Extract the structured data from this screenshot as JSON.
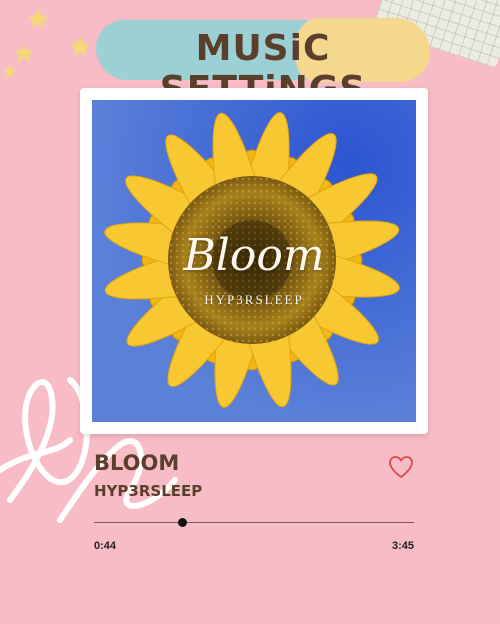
{
  "header": {
    "title": "MUSiC SETTiNGS"
  },
  "cover": {
    "title": "Bloom",
    "artist": "HYP3RSLEEP"
  },
  "track": {
    "title": "BLOOM",
    "artist": "HYP3RSLEEP"
  },
  "player": {
    "current_time": "0:44",
    "total_time": "3:45",
    "progress": 0.2756,
    "liked": false
  },
  "colors": {
    "background": "#f7bcc6",
    "text": "#5a3f2c",
    "banner_blue": "#9bd0d5",
    "banner_yellow": "#f4d98c",
    "heart": "#e0474e"
  },
  "icons": [
    "star-icon",
    "heart-icon"
  ]
}
